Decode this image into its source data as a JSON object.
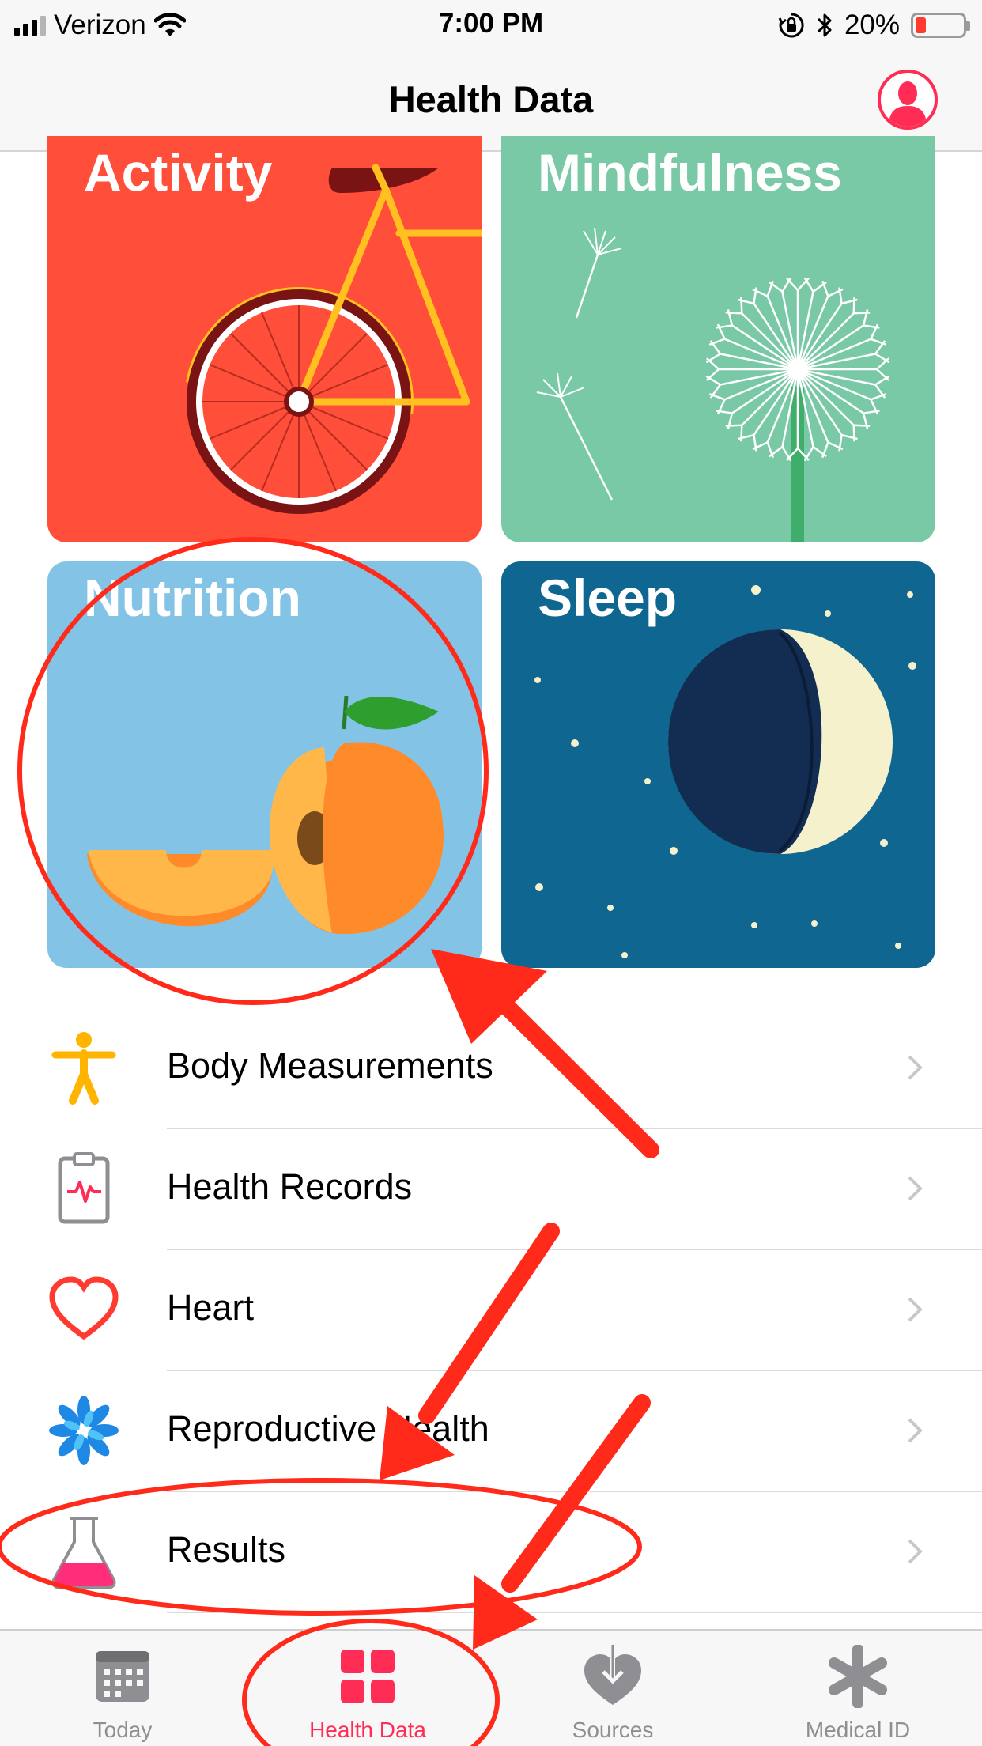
{
  "status_bar": {
    "carrier": "Verizon",
    "time": "7:00 PM",
    "battery_percent": "20%",
    "battery_level": 0.2,
    "icons": [
      "signal-icon",
      "wifi-icon",
      "orientation-lock-icon",
      "bluetooth-icon",
      "battery-icon"
    ]
  },
  "nav": {
    "title": "Health Data",
    "profile_icon": "profile-avatar-icon"
  },
  "categories": [
    {
      "label": "Activity",
      "color": "#ff4e3a",
      "icon": "bicycle-illustration"
    },
    {
      "label": "Mindfulness",
      "color": "#79c8a6",
      "icon": "dandelion-illustration"
    },
    {
      "label": "Nutrition",
      "color": "#83c4e6",
      "icon": "peach-illustration"
    },
    {
      "label": "Sleep",
      "color": "#0f6690",
      "icon": "moon-illustration"
    }
  ],
  "list": [
    {
      "label": "Body Measurements",
      "icon": "body-figure-icon"
    },
    {
      "label": "Health Records",
      "icon": "clipboard-icon"
    },
    {
      "label": "Heart",
      "icon": "heart-icon"
    },
    {
      "label": "Reproductive Health",
      "icon": "flower-icon"
    },
    {
      "label": "Results",
      "icon": "flask-icon"
    }
  ],
  "tabs": [
    {
      "label": "Today",
      "icon": "calendar-icon",
      "active": false
    },
    {
      "label": "Health Data",
      "icon": "grid-icon",
      "active": true
    },
    {
      "label": "Sources",
      "icon": "heart-download-icon",
      "active": false
    },
    {
      "label": "Medical ID",
      "icon": "asterisk-icon",
      "active": false
    }
  ],
  "colors": {
    "accent": "#ff2d55",
    "annotation": "#ff2a1a",
    "tab_inactive": "#8e8e93"
  }
}
